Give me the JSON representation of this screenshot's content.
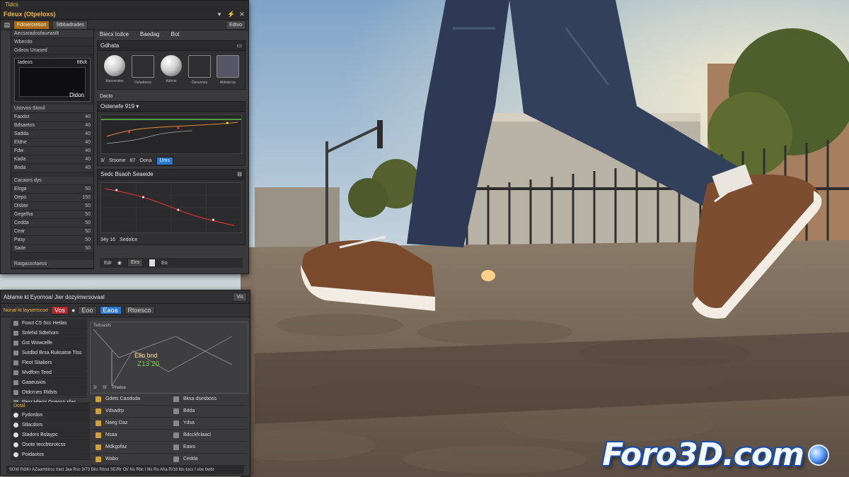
{
  "logo": {
    "text": "Foro3D.com"
  },
  "top_window": {
    "topbar_label": "Tidcs",
    "title": "Fdeux (Otpeloxs)",
    "toolbar_items": [
      "Fdmercretion",
      "Stbbadrades"
    ],
    "toolbar_right": "Edtvo",
    "left_panel": {
      "header": "Aecsaradosfaueasilt",
      "subheader1": "Wbecdo",
      "subheader2": "Gdeos Unased",
      "thumb_label": "Iadeos",
      "thumb_label_right": "8Bdt",
      "thumb_caption": "Didon",
      "section1_header": "Ustrvos-Stonil",
      "rows1": [
        {
          "label": "Faodst",
          "value": "40"
        },
        {
          "label": "Bdsaetos",
          "value": "40"
        },
        {
          "label": "Sadda",
          "value": "40"
        },
        {
          "label": "Eldne",
          "value": "40"
        },
        {
          "label": "Fdw",
          "value": "40"
        },
        {
          "label": "Kada",
          "value": "40"
        },
        {
          "label": "Boda",
          "value": "40"
        }
      ],
      "section2_header": "Cacaors dys",
      "rows2": [
        {
          "label": "Elsga",
          "value": "50"
        },
        {
          "label": "Oepo",
          "value": "150"
        },
        {
          "label": "Dlsbte",
          "value": "50"
        },
        {
          "label": "Gegelha",
          "value": "50"
        },
        {
          "label": "Cedda",
          "value": "50"
        },
        {
          "label": "Cear",
          "value": "50"
        },
        {
          "label": "Pasy",
          "value": "50"
        },
        {
          "label": "Sade",
          "value": "50"
        }
      ],
      "footer": "Ratgassotaess"
    },
    "main": {
      "tabs": [
        "Biecx Icdce",
        "Baedag",
        "Bot"
      ],
      "section_title": "Gdhata",
      "materials": [
        {
          "caption": "Aiecmrrdes"
        },
        {
          "caption": "Oeladoess"
        },
        {
          "caption": "Aldrcie"
        },
        {
          "caption": "Oesucnes"
        },
        {
          "caption": "Aldedcrus"
        }
      ],
      "graph_title": "Dacto",
      "graph_header": "Ostenefe",
      "graph_header_value": "919",
      "graph_footer": [
        "3/",
        "Stsome",
        "87",
        "Oona",
        "Ums"
      ],
      "spline_title": "Sedc Bsaoh Seaeide",
      "bottom_label": "34y 16",
      "bottom_sub": "Sedolce",
      "btn_bar": [
        "Edr",
        "Eirs",
        "Eo"
      ]
    }
  },
  "bottom_window": {
    "title": "Ablame kt Eyornoa/ Jier dozyimersovaal",
    "title_right": "Vis",
    "toolbar_left": "Nonal kt laysertscoe",
    "toolbar_chips": [
      "Vos",
      "Eoo",
      "Eaoa",
      "Rtoesco"
    ],
    "list": [
      "Foxct C5 Scc Hetlas",
      "Snlehd Sdtehom",
      "Gst Wowcelfe",
      "Sutdbd Brsa Ruksatse Tlss",
      "Fleot Sitaliors",
      "Mvdfom Teed",
      "Gaaeusios",
      "Otdcrnes Rldsts",
      "Resr Hleoir Goeosn sfas"
    ],
    "viewport_label": "Tettoaslls",
    "viewport_text": "Ello bnd",
    "viewport_text2": "Z13 20",
    "viewport_footer": [
      "3/",
      "Sf",
      "Pnatoa"
    ],
    "lower_header": "Dotal",
    "lower_rows": [
      "Fydordos",
      "Stlacdors",
      "Stadors Bslaypc",
      "Osote teccbtsrotcss",
      "Poidaotos"
    ],
    "grid": [
      [
        "Gdets Caododa",
        "Bksa dsesboss"
      ],
      [
        "Vdsadrp",
        "Bdda"
      ],
      [
        "Naeg Oaz",
        "Ydsa"
      ],
      [
        "Nsaa",
        "Bdcckfclaacl"
      ],
      [
        "Mdkgofaz",
        "Eaws"
      ],
      [
        "Wabo",
        "Cedda"
      ]
    ],
    "statusbar": "SDW RdiKr AZaambtrcc t/act Jaa Rsc 3/73 Bits Rbsd SE/Rr Ot/ Ns Rbc l hls Ro Aha R/16 tbs tocs f sbe bwbr"
  }
}
